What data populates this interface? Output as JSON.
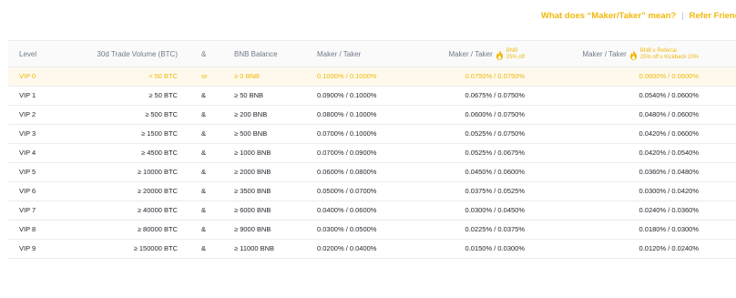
{
  "links": {
    "maker_taker": "What does “Maker/Taker” mean?",
    "separator": "|",
    "refer": "Refer Friends t"
  },
  "header": {
    "level": "Level",
    "volume": "30d Trade Volume (BTC)",
    "op": "&",
    "bnb_balance": "BNB Balance",
    "maker_taker": "Maker  /  Taker",
    "bnb_maker_taker": "Maker  /  Taker",
    "bnb_tag_line1": "BNB",
    "bnb_tag_line2": "25% off",
    "ref_maker_taker": "Maker  /  Taker",
    "ref_tag_line1": "BNB x Referral",
    "ref_tag_line2": "25% off x Kickback 20%"
  },
  "rows": [
    {
      "level": "VIP 0",
      "volume": "< 50 BTC",
      "op": "or",
      "bnb": "≥ 0 BNB",
      "maker_taker": "0.1000% / 0.1000%",
      "bnb_discount": "0.0750% / 0.0750%",
      "referral": "0.0600% /  0.0600%"
    },
    {
      "level": "VIP 1",
      "volume": "≥ 50 BTC",
      "op": "&",
      "bnb": "≥ 50 BNB",
      "maker_taker": "0.0900% / 0.1000%",
      "bnb_discount": "0.0675% / 0.0750%",
      "referral": "0.0540% /  0.0600%"
    },
    {
      "level": "VIP 2",
      "volume": "≥ 500 BTC",
      "op": "&",
      "bnb": "≥ 200 BNB",
      "maker_taker": "0.0800% / 0.1000%",
      "bnb_discount": "0.0600% / 0.0750%",
      "referral": "0.0480% /  0.0600%"
    },
    {
      "level": "VIP 3",
      "volume": "≥ 1500 BTC",
      "op": "&",
      "bnb": "≥ 500 BNB",
      "maker_taker": "0.0700% / 0.1000%",
      "bnb_discount": "0.0525% / 0.0750%",
      "referral": "0.0420% /  0.0600%"
    },
    {
      "level": "VIP 4",
      "volume": "≥ 4500 BTC",
      "op": "&",
      "bnb": "≥ 1000 BNB",
      "maker_taker": "0.0700% / 0.0900%",
      "bnb_discount": "0.0525% / 0.0675%",
      "referral": "0.0420% /  0.0540%"
    },
    {
      "level": "VIP 5",
      "volume": "≥ 10000 BTC",
      "op": "&",
      "bnb": "≥ 2000 BNB",
      "maker_taker": "0.0600% / 0.0800%",
      "bnb_discount": "0.0450% / 0.0600%",
      "referral": "0.0360% /  0.0480%"
    },
    {
      "level": "VIP 6",
      "volume": "≥ 20000 BTC",
      "op": "&",
      "bnb": "≥ 3500 BNB",
      "maker_taker": "0.0500% / 0.0700%",
      "bnb_discount": "0.0375% / 0.0525%",
      "referral": "0.0300% /  0.0420%"
    },
    {
      "level": "VIP 7",
      "volume": "≥ 40000 BTC",
      "op": "&",
      "bnb": "≥ 6000 BNB",
      "maker_taker": "0.0400% / 0.0600%",
      "bnb_discount": "0.0300% / 0.0450%",
      "referral": "0.0240% /  0.0360%"
    },
    {
      "level": "VIP 8",
      "volume": "≥ 80000 BTC",
      "op": "&",
      "bnb": "≥ 9000 BNB",
      "maker_taker": "0.0300% / 0.0500%",
      "bnb_discount": "0.0225% / 0.0375%",
      "referral": "0.0180% /  0.0300%"
    },
    {
      "level": "VIP 9",
      "volume": "≥ 150000 BTC",
      "op": "&",
      "bnb": "≥ 11000 BNB",
      "maker_taker": "0.0200% / 0.0400%",
      "bnb_discount": "0.0150% / 0.0300%",
      "referral": "0.0120% /  0.0240%"
    }
  ],
  "colors": {
    "accent": "#f0b90b",
    "highlight_row": "#fef9ec",
    "header_text": "#707a8a",
    "body_text": "#1e2329",
    "border": "#eaecef"
  },
  "icons": [
    "flame-icon"
  ]
}
